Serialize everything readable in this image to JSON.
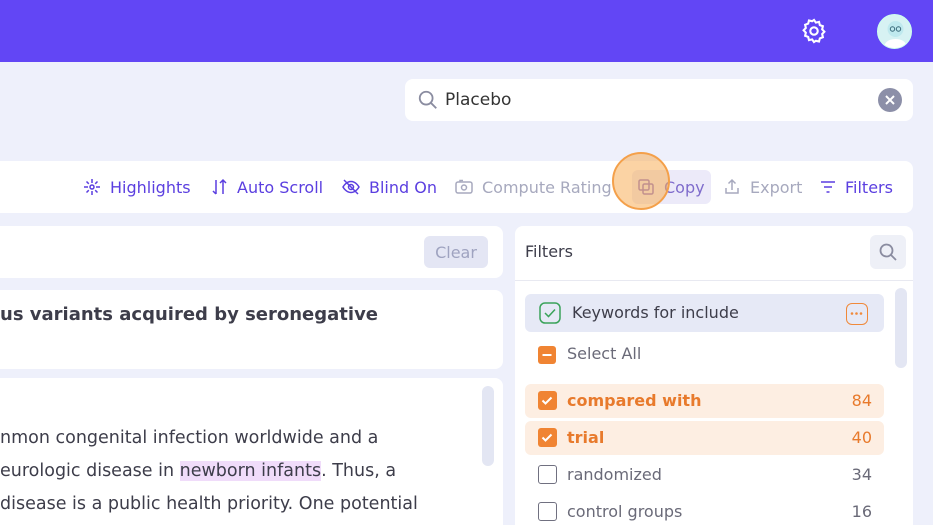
{
  "search": {
    "value": "Placebo"
  },
  "toolbar": {
    "highlights": "Highlights",
    "auto_scroll": "Auto Scroll",
    "blind_on": "Blind On",
    "compute_rating": "Compute Rating",
    "copy": "Copy",
    "export": "Export",
    "filters": "Filters"
  },
  "clear_button": "Clear",
  "article": {
    "title_fragment": "us variants acquired by seronegative",
    "abstract_lines": [
      "nmon congenital infection worldwide and a",
      "eurologic disease in ",
      "newborn infants",
      ". Thus, a",
      " disease is a public health priority. One potential"
    ]
  },
  "filters": {
    "title": "Filters",
    "group_label": "Keywords for include",
    "select_all": "Select All",
    "items": [
      {
        "label": "compared with",
        "count": "84",
        "checked": true
      },
      {
        "label": "trial",
        "count": "40",
        "checked": true
      },
      {
        "label": "randomized",
        "count": "34",
        "checked": false
      },
      {
        "label": "control groups",
        "count": "16",
        "checked": false
      }
    ]
  },
  "colors": {
    "topbar": "#6246f5",
    "accent": "#5b3fe0",
    "orange": "#f08433",
    "background": "#eef0fb"
  },
  "icons": [
    "gear-icon",
    "avatar",
    "search-icon",
    "clear-icon",
    "highlights-icon",
    "auto-scroll-icon",
    "blind-icon",
    "compute-rating-icon",
    "copy-icon",
    "export-icon",
    "filter-icon",
    "check-icon",
    "more-icon"
  ]
}
